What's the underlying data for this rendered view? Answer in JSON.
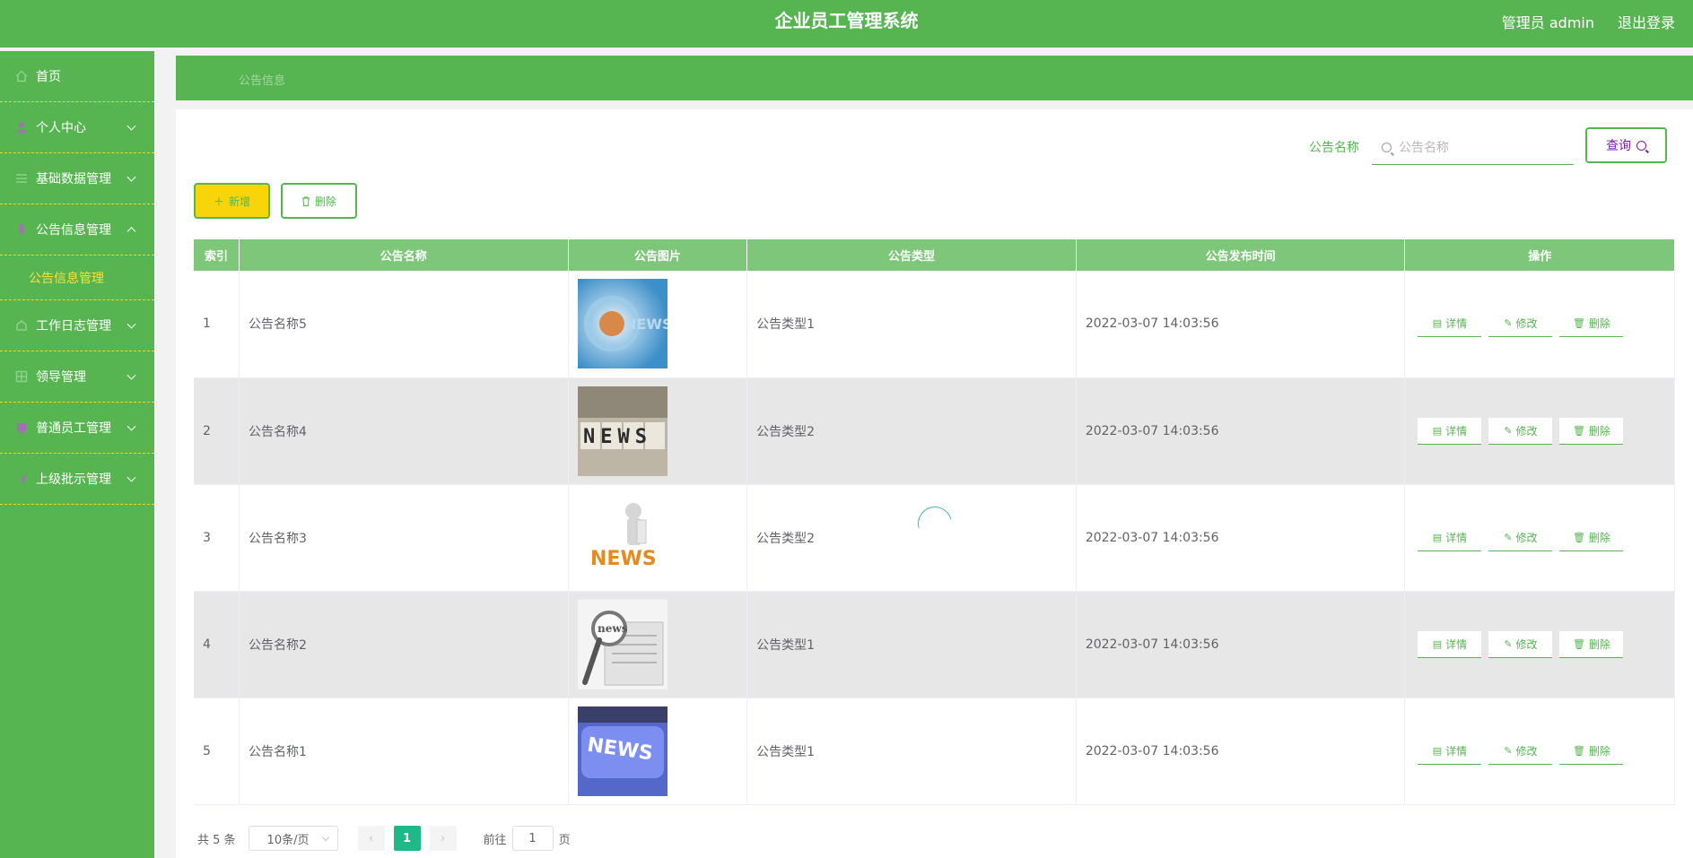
{
  "header": {
    "title": "企业员工管理系统",
    "user": "管理员 admin",
    "logout": "退出登录"
  },
  "sidebar": {
    "items": [
      {
        "label": "首页",
        "icon": "home-icon"
      },
      {
        "label": "个人中心",
        "icon": "user-icon"
      },
      {
        "label": "基础数据管理",
        "icon": "data-icon"
      },
      {
        "label": "公告信息管理",
        "icon": "notice-icon"
      },
      {
        "label": "工作日志管理",
        "icon": "log-icon"
      },
      {
        "label": "领导管理",
        "icon": "leader-icon"
      },
      {
        "label": "普通员工管理",
        "icon": "staff-icon"
      },
      {
        "label": "上级批示管理",
        "icon": "approval-icon"
      }
    ],
    "sub_item": "公告信息管理"
  },
  "breadcrumb": "公告信息",
  "search": {
    "label": "公告名称",
    "placeholder": "公告名称",
    "button": "查询"
  },
  "actions": {
    "add": "新增",
    "delete": "删除"
  },
  "table": {
    "columns": [
      "索引",
      "公告名称",
      "公告图片",
      "公告类型",
      "公告发布时间",
      "操作"
    ],
    "rows": [
      {
        "index": "1",
        "name": "公告名称5",
        "type": "公告类型1",
        "time": "2022-03-07 14:03:56"
      },
      {
        "index": "2",
        "name": "公告名称4",
        "type": "公告类型2",
        "time": "2022-03-07 14:03:56"
      },
      {
        "index": "3",
        "name": "公告名称3",
        "type": "公告类型2",
        "time": "2022-03-07 14:03:56"
      },
      {
        "index": "4",
        "name": "公告名称2",
        "type": "公告类型1",
        "time": "2022-03-07 14:03:56"
      },
      {
        "index": "5",
        "name": "公告名称1",
        "type": "公告类型1",
        "time": "2022-03-07 14:03:56"
      }
    ],
    "ops": {
      "detail": "详情",
      "edit": "修改",
      "delete": "删除"
    }
  },
  "pagination": {
    "total": "共 5 条",
    "page_size": "10条/页",
    "current": "1",
    "goto_prefix": "前往",
    "goto_value": "1",
    "goto_suffix": "页"
  },
  "images": {
    "r1_text": "NEWS",
    "r2_text": "NEWS",
    "r3_text": "NEWS",
    "r4_text": "news",
    "r5_text": "NEWS"
  }
}
